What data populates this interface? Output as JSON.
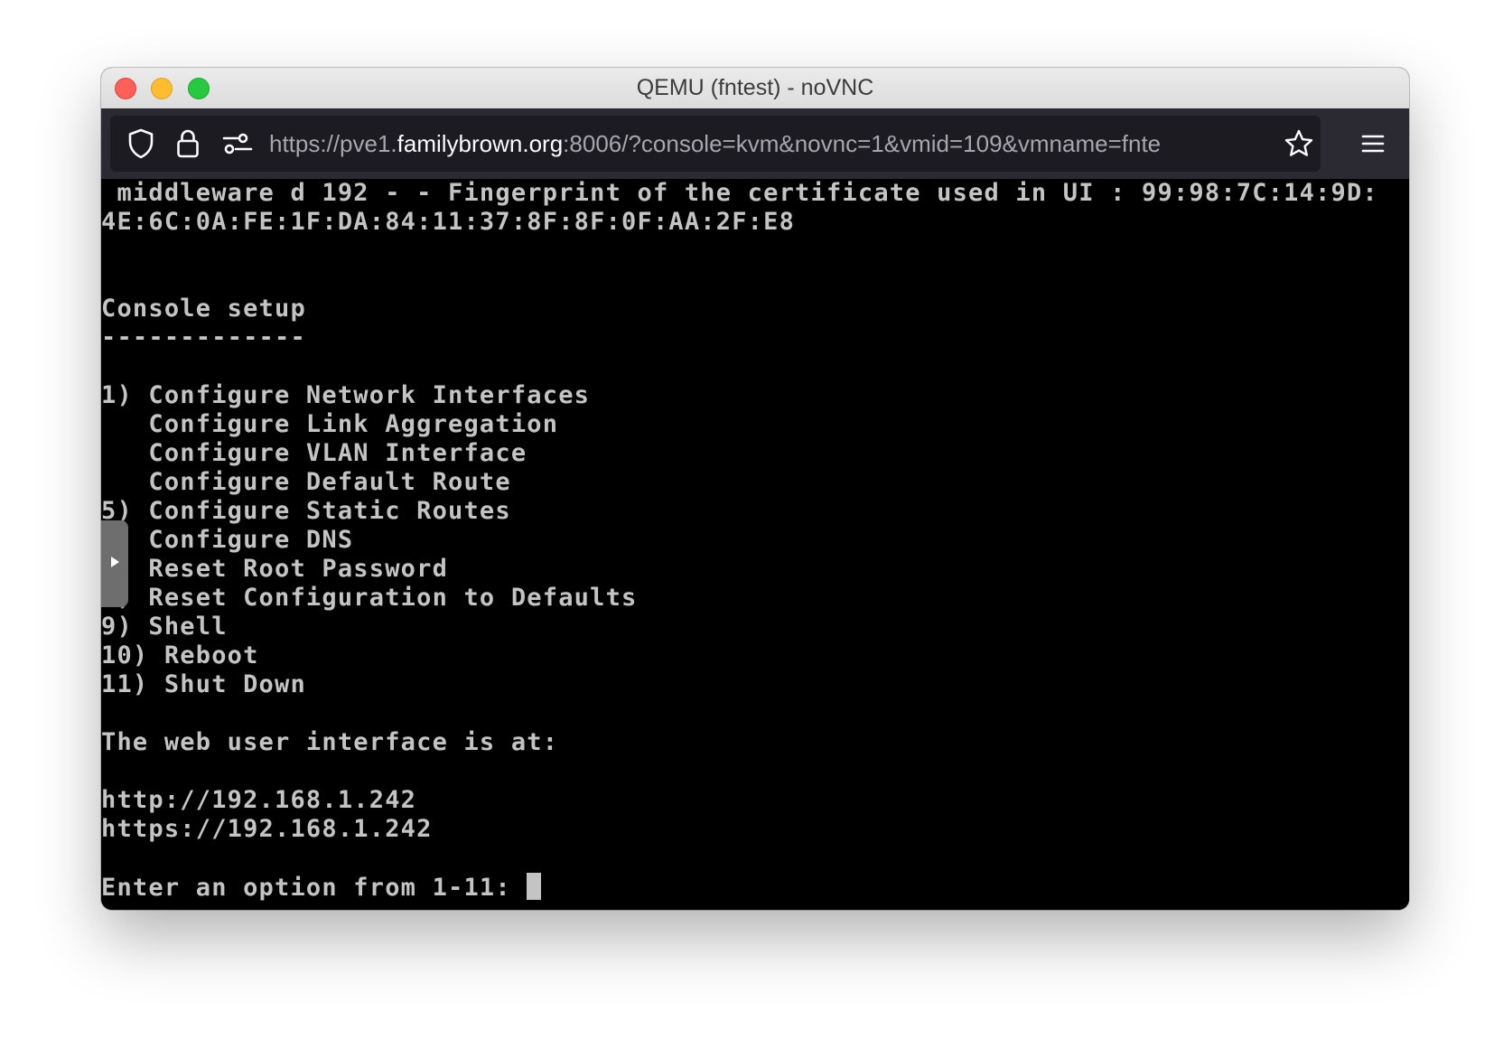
{
  "window": {
    "title": "QEMU (fntest) - noVNC"
  },
  "toolbar": {
    "url_prefix": "https://pve1.",
    "url_host": "familybrown.org",
    "url_suffix": ":8006/?console=kvm&novnc=1&vmid=109&vmname=fnte",
    "icons": [
      "shield-icon",
      "lock-icon",
      "permissions-icon",
      "bookmark-star-icon",
      "hamburger-menu-icon"
    ]
  },
  "console": {
    "lines": [
      " middleware d 192 - - Fingerprint of the certificate used in UI : 99:98:7C:14:9D:",
      "4E:6C:0A:FE:1F:DA:84:11:37:8F:8F:0F:AA:2F:E8",
      "",
      "",
      "Console setup",
      "-------------",
      "",
      "1) Configure Network Interfaces",
      "   Configure Link Aggregation",
      "   Configure VLAN Interface",
      "   Configure Default Route",
      "5) Configure Static Routes",
      "6) Configure DNS",
      "7) Reset Root Password",
      "8) Reset Configuration to Defaults",
      "9) Shell",
      "10) Reboot",
      "11) Shut Down",
      "",
      "The web user interface is at:",
      "",
      "http://192.168.1.242",
      "https://192.168.1.242",
      "",
      "Enter an option from 1-11: "
    ]
  },
  "sidebar_handle": {
    "icon": "play-arrow-icon"
  }
}
